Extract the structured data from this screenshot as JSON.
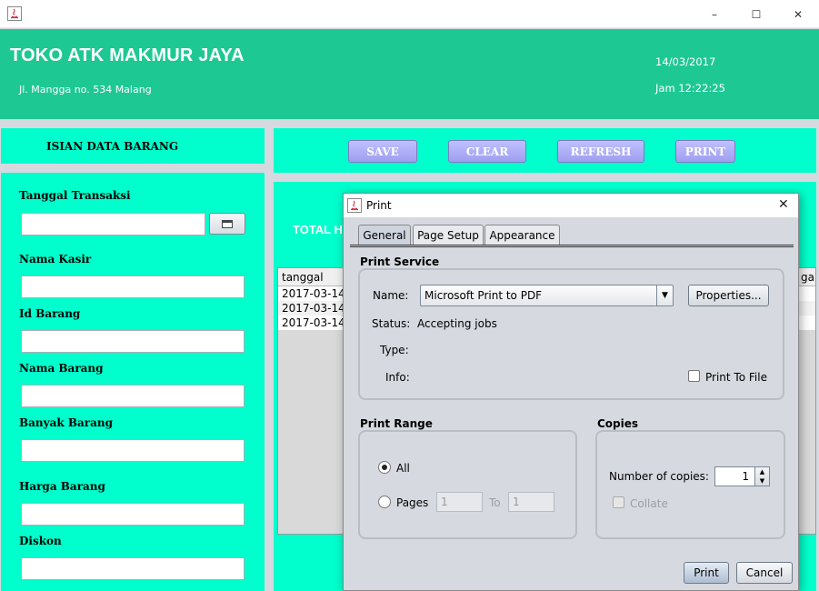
{
  "window": {
    "controls": {
      "minimize": "–",
      "maximize": "☐",
      "close": "✕"
    }
  },
  "header": {
    "store_name": "TOKO ATK MAKMUR JAYA",
    "address": "Jl. Mangga no. 534 Malang",
    "date": "14/03/2017",
    "time": "Jam 12:22:25"
  },
  "form": {
    "title": "ISIAN DATA BARANG",
    "labels": {
      "tanggal": "Tanggal Transaksi",
      "kasir": "Nama Kasir",
      "id": "Id Barang",
      "nama": "Nama Barang",
      "banyak": "Banyak Barang",
      "harga": "Harga Barang",
      "diskon": "Diskon"
    },
    "values": {
      "tanggal": "",
      "kasir": "",
      "id": "",
      "nama": "",
      "banyak": "",
      "harga": "",
      "diskon": ""
    }
  },
  "toolbar": {
    "save": "SAVE",
    "clear": "CLEAR",
    "refresh": "REFRESH",
    "print": "PRINT"
  },
  "main": {
    "total_label": "TOTAL H",
    "table": {
      "columns": [
        "tanggal",
        "ga"
      ],
      "rows": [
        "2017-03-14",
        "2017-03-14",
        "2017-03-14"
      ]
    }
  },
  "dialog": {
    "title": "Print",
    "close": "✕",
    "tabs": [
      "General",
      "Page Setup",
      "Appearance"
    ],
    "print_service": {
      "title": "Print Service",
      "name_label": "Name:",
      "name_value": "Microsoft Print to PDF",
      "properties_button": "Properties...",
      "status_label": "Status:",
      "status_value": "Accepting jobs",
      "type_label": "Type:",
      "info_label": "Info:",
      "print_to_file": "Print To File"
    },
    "print_range": {
      "title": "Print Range",
      "all": "All",
      "pages": "Pages",
      "from": "1",
      "to_label": "To",
      "to": "1"
    },
    "copies": {
      "title": "Copies",
      "number_label": "Number of copies:",
      "number_value": "1",
      "collate": "Collate"
    },
    "print_button": "Print",
    "cancel_button": "Cancel"
  }
}
